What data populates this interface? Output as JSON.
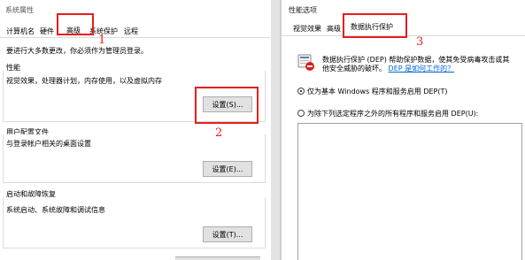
{
  "left_window": {
    "title": "系统属性",
    "tabs": [
      "计算机名",
      "硬件",
      "高级",
      "系统保护",
      "远程"
    ],
    "admin_note": "要进行大多数更改，你必须作为管理员登录。",
    "groups": [
      {
        "title": "性能",
        "desc": "视觉效果，处理器计划，内存使用，以及虚拟内存",
        "button": "设置(S)..."
      },
      {
        "title": "用户配置文件",
        "desc": "与登录帐户相关的桌面设置",
        "button": "设置(E)..."
      },
      {
        "title": "启动和故障恢复",
        "desc": "系统启动、系统故障和调试信息",
        "button": "设置(T)..."
      }
    ]
  },
  "right_window": {
    "title": "性能选项",
    "tabs": [
      "视觉效果",
      "高级",
      "数据执行保护"
    ],
    "dep_text_1": "数据执行保护 (DEP) 帮助保护数据，使其免受病毒攻击或其",
    "dep_text_2": "他安全威胁的破坏。",
    "dep_link": "DEP 是如何工作的？",
    "option_1": "仅为基本 Windows 程序和服务启用 DEP(T)",
    "option_2": "为除下列选定程序之外的所有程序和服务启用 DEP(U):"
  },
  "annotations": [
    "1",
    "2",
    "3"
  ],
  "annotation_color": "#e51e1e"
}
